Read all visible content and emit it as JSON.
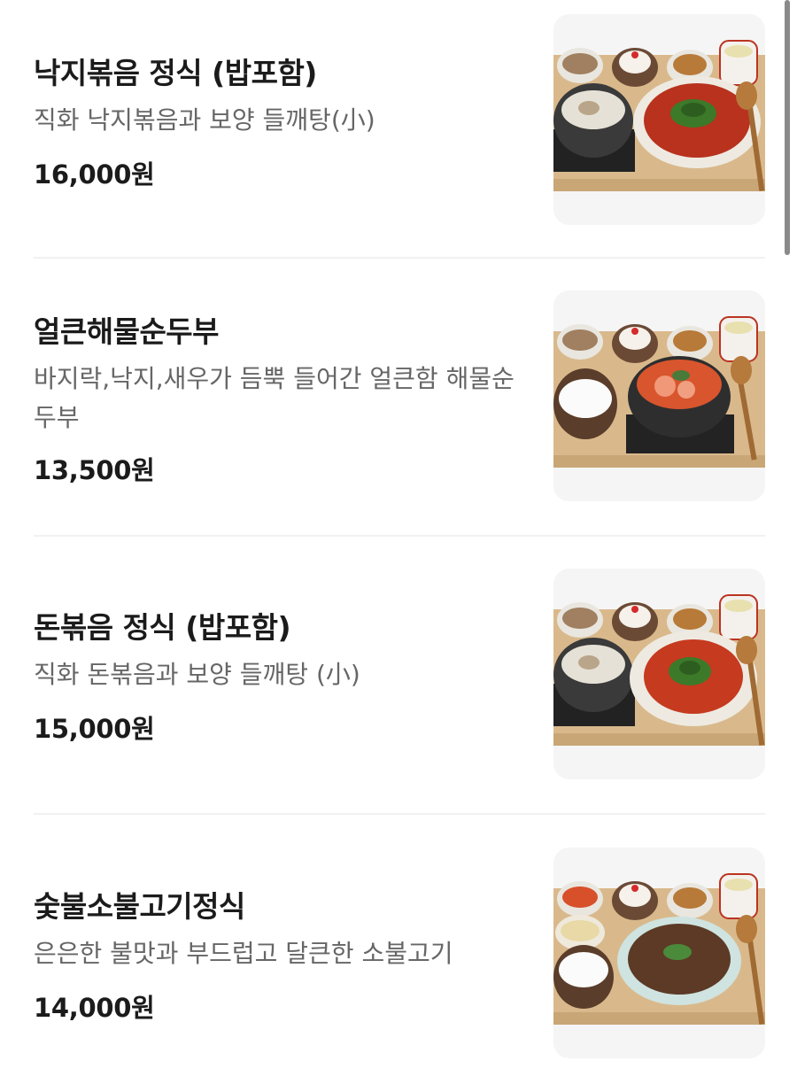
{
  "menu": {
    "items": [
      {
        "name": "낙지볶음 정식 (밥포함)",
        "description": "직화 낙지볶음과 보양 들깨탕(小)",
        "price": "16,000원",
        "photo_icon": "octopus-set-meal-icon"
      },
      {
        "name": "얼큰해물순두부",
        "description": "바지락,낙지,새우가 듬뿍 들어간 얼큰함 해물순두부",
        "price": "13,500원",
        "photo_icon": "seafood-tofu-stew-icon"
      },
      {
        "name": "돈볶음 정식 (밥포함)",
        "description": "직화 돈볶음과 보양 들깨탕 (小)",
        "price": "15,000원",
        "photo_icon": "pork-set-meal-icon"
      },
      {
        "name": "숯불소불고기정식",
        "description": "은은한 불맛과 부드럽고 달큰한 소불고기",
        "price": "14,000원",
        "photo_icon": "bulgogi-set-meal-icon"
      }
    ]
  },
  "colors": {
    "text_primary": "#1b1b1b",
    "text_secondary": "#666666",
    "divider": "#f1f1f1",
    "photo_bg": "#f4f4f4",
    "tray_wood": "#d9b98c"
  }
}
